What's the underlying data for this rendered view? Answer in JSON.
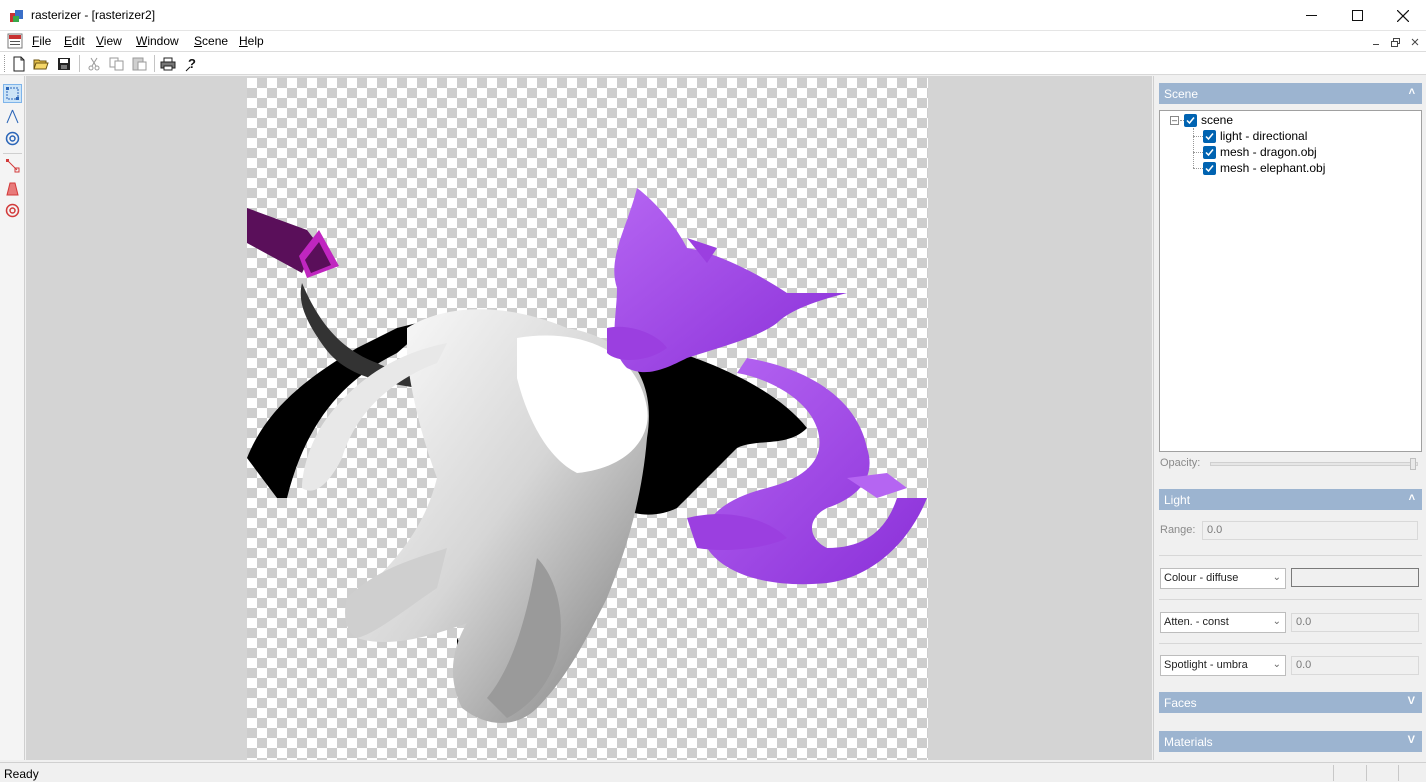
{
  "window": {
    "title": "rasterizer - [rasterizer2]",
    "minimize_icon": "minimize-icon",
    "maximize_icon": "maximize-icon",
    "close_icon": "close-icon"
  },
  "menu": {
    "items": [
      {
        "label": "File",
        "accel": "F"
      },
      {
        "label": "Edit",
        "accel": "E"
      },
      {
        "label": "View",
        "accel": "V"
      },
      {
        "label": "Window",
        "accel": "W"
      },
      {
        "label": "Scene",
        "accel": "S"
      },
      {
        "label": "Help",
        "accel": "H"
      }
    ]
  },
  "toolbar": {
    "buttons": [
      "new-document-icon",
      "open-folder-icon",
      "save-icon",
      "cut-icon",
      "copy-icon",
      "paste-icon",
      "print-icon",
      "help-icon"
    ]
  },
  "left_tools": {
    "buttons": [
      "select-camera-icon",
      "camera-perspective-icon",
      "camera-orbit-icon",
      "select-light-icon",
      "light-perspective-icon",
      "light-orbit-icon"
    ]
  },
  "scene_panel": {
    "header": "Scene",
    "tree": {
      "root": "scene",
      "children": [
        "light - directional",
        "mesh - dragon.obj",
        "mesh - elephant.obj"
      ]
    },
    "opacity_label": "Opacity:"
  },
  "light_panel": {
    "header": "Light",
    "range_label": "Range:",
    "range_value": "0.0",
    "colour_select": "Colour - diffuse",
    "atten_select": "Atten. - const",
    "atten_value": "0.0",
    "spotlight_select": "Spotlight - umbra",
    "spotlight_value": "0.0"
  },
  "faces_panel": {
    "header": "Faces"
  },
  "materials_panel": {
    "header": "Materials"
  },
  "status": {
    "text": "Ready"
  },
  "colors": {
    "panel_header": "#9cb4d0",
    "checkbox": "#0063b1",
    "dragon": "#9b3fe0",
    "light_marker": "#7a1a7a"
  }
}
